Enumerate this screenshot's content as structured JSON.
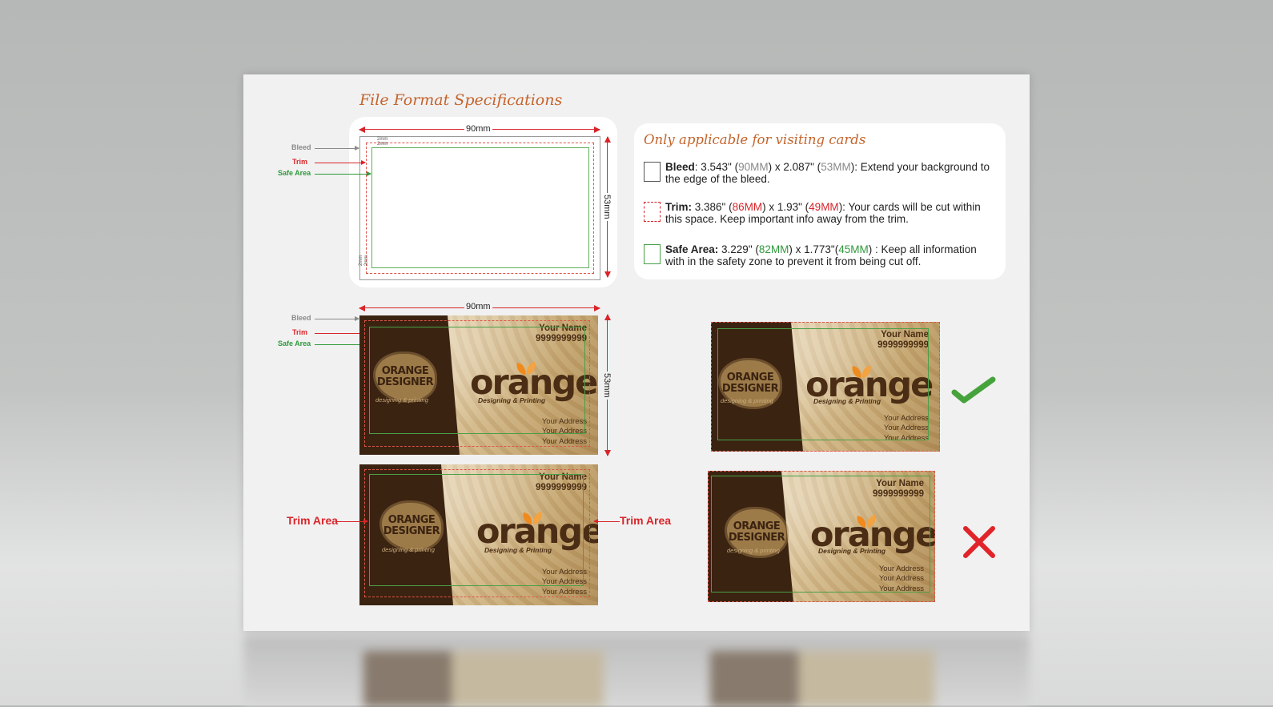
{
  "title": "File Format Specifications",
  "diagram": {
    "labels": {
      "bleed": "Bleed",
      "trim": "Trim",
      "safe": "Safe Area"
    },
    "width_label": "90mm",
    "height_label": "53mm",
    "margin_label": "2mm"
  },
  "info": {
    "heading": "Only applicable for visiting cards",
    "bleed": {
      "term": "Bleed",
      "text_a": ": 3.543\" (",
      "mm_w": "90MM",
      "text_b": ") x 2.087\" (",
      "mm_h": "53MM",
      "text_c": "): Extend your background to the edge of the bleed."
    },
    "trim": {
      "term": "Trim:",
      "text_a": " 3.386\" (",
      "mm_w": "86MM",
      "text_b": ") x 1.93\" (",
      "mm_h": "49MM",
      "text_c": "): Your cards will be cut within this space. Keep important info away from the trim."
    },
    "safe": {
      "term": "Safe Area:",
      "text_a": " 3.229\" (",
      "mm_w": "82MM",
      "text_b": ") x 1.773\"(",
      "mm_h": "45MM",
      "text_c": ") : Keep all information with in the safety zone to prevent it from being cut off."
    }
  },
  "card": {
    "badge_line1": "ORANGE",
    "badge_line2": "DESIGNER",
    "tagline": "designing & printing",
    "name": "Your Name",
    "phone": "9999999999",
    "brand": "orange",
    "brand_sub": "Designing & Printing",
    "address_line": "Your Address"
  },
  "trim_area_label": "Trim Area",
  "colors": {
    "accent": "#c4632b",
    "trim_red": "#d8252a",
    "safe_green": "#2f9a3c",
    "bleed_gray": "#8a8a8a",
    "card_brown": "#3b2311",
    "leaf_orange": "#f08a1c"
  },
  "icons": {
    "correct": "check-mark-icon",
    "wrong": "cross-mark-icon"
  }
}
